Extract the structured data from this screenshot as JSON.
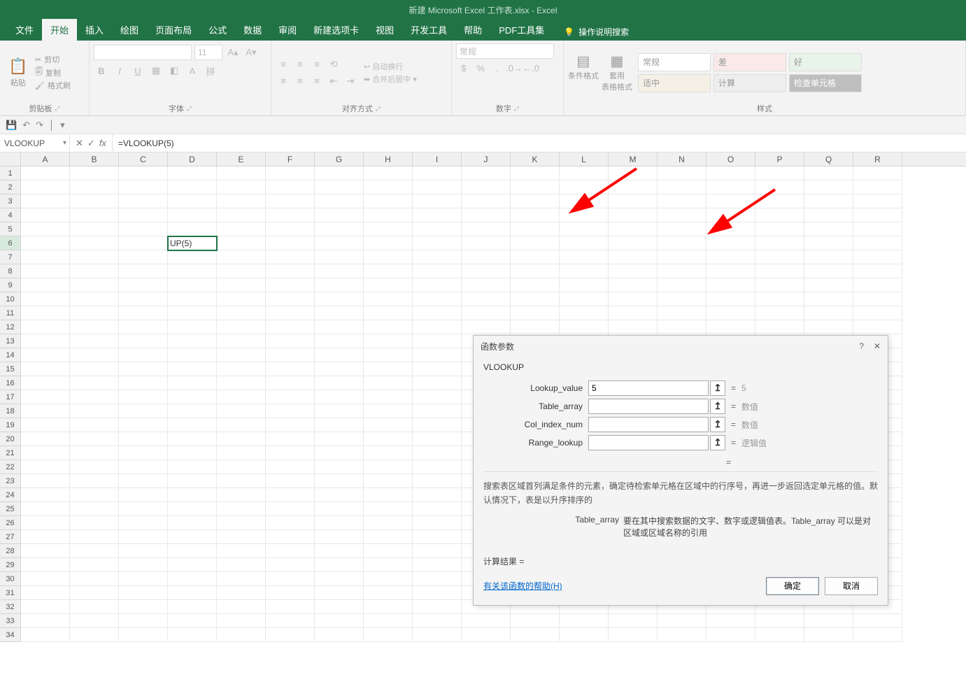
{
  "title": "新建 Microsoft Excel 工作表.xlsx  -  Excel",
  "tabs": {
    "file": "文件",
    "home": "开始",
    "insert": "插入",
    "draw": "绘图",
    "layout": "页面布局",
    "formulas": "公式",
    "data": "数据",
    "review": "审阅",
    "newtab": "新建选项卡",
    "view": "视图",
    "dev": "开发工具",
    "help": "帮助",
    "pdf": "PDF工具集",
    "tellme": "操作说明搜索"
  },
  "ribbon": {
    "clipboard": {
      "paste": "粘贴",
      "cut": "剪切",
      "copy": "复制",
      "painter": "格式刷",
      "label": "剪贴板"
    },
    "font": {
      "size": "11",
      "label": "字体"
    },
    "align": {
      "wrap": "自动换行",
      "merge": "合并后居中",
      "label": "对齐方式"
    },
    "number": {
      "general": "常规",
      "label": "数字"
    },
    "styles": {
      "cond": "条件格式",
      "table": "套用\n表格格式",
      "normal": "常规",
      "bad": "差",
      "good": "好",
      "neutral": "适中",
      "calc": "计算",
      "check": "检查单元格",
      "label": "样式"
    }
  },
  "namebox": "VLOOKUP",
  "formula": "=VLOOKUP(5)",
  "columns": [
    "A",
    "B",
    "C",
    "D",
    "E",
    "F",
    "G",
    "H",
    "I",
    "J",
    "K",
    "L",
    "M",
    "N",
    "O",
    "P",
    "Q",
    "R"
  ],
  "rows_count": 34,
  "active_cell": {
    "row": 6,
    "col": "D",
    "display": "UP(5)"
  },
  "dialog": {
    "title": "函数参数",
    "fn": "VLOOKUP",
    "args": {
      "lookup_value": {
        "label": "Lookup_value",
        "value": "5",
        "result": "5"
      },
      "table_array": {
        "label": "Table_array",
        "value": "",
        "result": "数值"
      },
      "col_index_num": {
        "label": "Col_index_num",
        "value": "",
        "result": "数值"
      },
      "range_lookup": {
        "label": "Range_lookup",
        "value": "",
        "result": "逻辑值"
      }
    },
    "eq": "=",
    "desc_main": "搜索表区域首列满足条件的元素，确定待检索单元格在区域中的行序号，再进一步返回选定单元格的值。默认情况下，表是以升序排序的",
    "arg_desc_label": "Table_array",
    "arg_desc_text": "要在其中搜索数据的文字、数字或逻辑值表。Table_array 可以是对区域或区域名称的引用",
    "calc_result": "计算结果 =",
    "help": "有关该函数的帮助(H)",
    "ok": "确定",
    "cancel": "取消",
    "help_icon": "?",
    "close_icon": "✕"
  }
}
